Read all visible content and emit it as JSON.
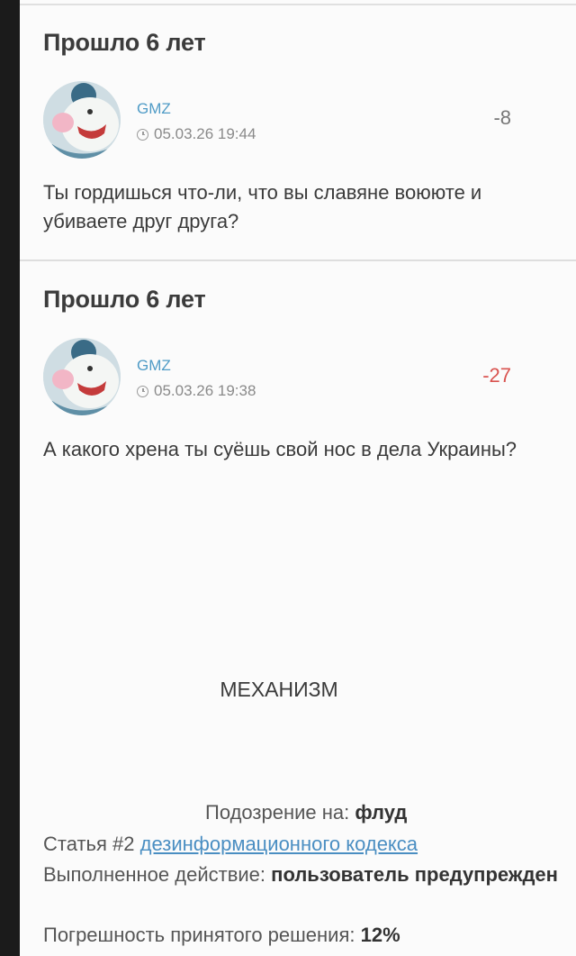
{
  "posts": [
    {
      "title": "Прошло 6 лет",
      "author": "GMZ",
      "datetime": "05.03.26 19:44",
      "score": "-8",
      "score_color": "#777777",
      "text": "Ты гордишься что-ли, что вы славяне воююте и убиваете друг друга?"
    },
    {
      "title": "Прошло 6 лет",
      "author": "GMZ",
      "datetime": "05.03.26 19:38",
      "score": "-27",
      "score_color": "#d9534f",
      "text": "А какого хрена ты суёшь свой нос в дела Украины?"
    }
  ],
  "mechanism": {
    "title": "МЕХАНИЗМ",
    "suspicion_label": "Подозрение на:",
    "suspicion_value": "флуд",
    "article_prefix": "Статья #2",
    "article_link": "дезинформационного кодекса",
    "action_label": "Выполненное действие:",
    "action_value": "пользователь предупрежден",
    "error_label": "Погрешность принятого решения:",
    "error_value": "12%"
  }
}
